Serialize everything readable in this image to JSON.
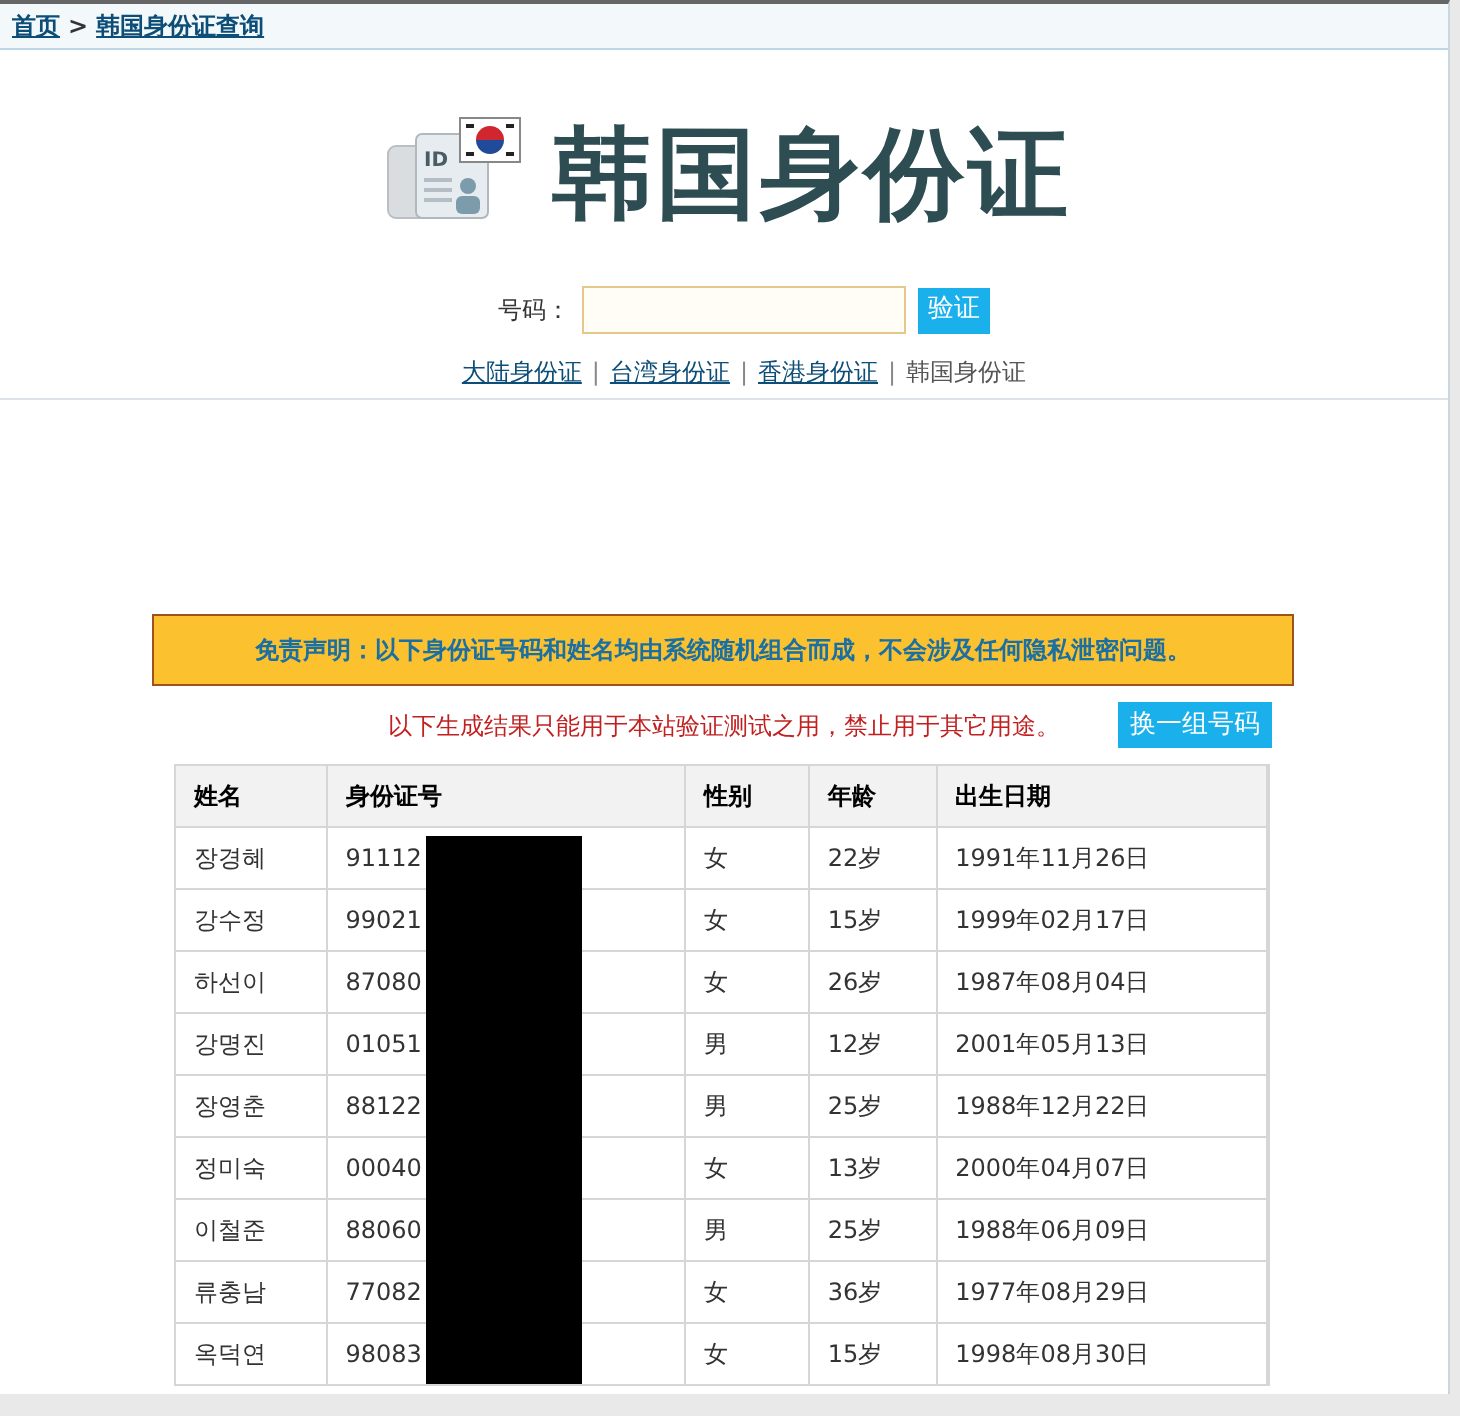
{
  "breadcrumb": {
    "home": "首页",
    "separator": ">",
    "current": "韩国身份证查询"
  },
  "logo": {
    "title": "韩国身份证",
    "card_label": "ID"
  },
  "search": {
    "label": "号码：",
    "button": "验证"
  },
  "links": [
    {
      "label": "大陆身份证",
      "selected": false
    },
    {
      "label": "台湾身份证",
      "selected": false
    },
    {
      "label": "香港身份证",
      "selected": false
    },
    {
      "label": "韩国身份证",
      "selected": true
    }
  ],
  "link_separator": "|",
  "disclaimer": "免责声明：以下身份证号码和姓名均由系统随机组合而成，不会涉及任何隐私泄密问题。",
  "notice": "以下生成结果只能用于本站验证测试之用，禁止用于其它用途。",
  "regenerate_button": "换一组号码",
  "table": {
    "columns": [
      "姓名",
      "身份证号",
      "性别",
      "年龄",
      "出生日期"
    ],
    "rows": [
      [
        "장경혜",
        "91112",
        "女",
        "22岁",
        "1991年11月26日"
      ],
      [
        "강수정",
        "99021",
        "女",
        "15岁",
        "1999年02月17日"
      ],
      [
        "하선이",
        "87080",
        "女",
        "26岁",
        "1987年08月04日"
      ],
      [
        "강명진",
        "01051",
        "男",
        "12岁",
        "2001年05月13日"
      ],
      [
        "장영춘",
        "88122",
        "男",
        "25岁",
        "1988年12月22日"
      ],
      [
        "정미숙",
        "00040",
        "女",
        "13岁",
        "2000年04月07日"
      ],
      [
        "이철준",
        "88060",
        "男",
        "25岁",
        "1988年06月09日"
      ],
      [
        "류충남",
        "77082",
        "女",
        "36岁",
        "1977年08月29日"
      ],
      [
        "옥덕연",
        "98083",
        "女",
        "15岁",
        "1998年08月30日"
      ]
    ]
  }
}
